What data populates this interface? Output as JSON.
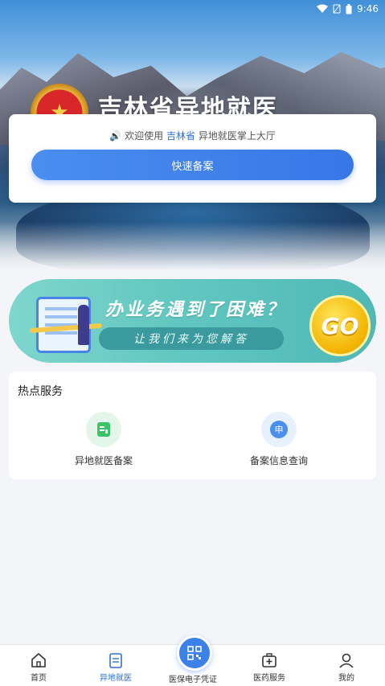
{
  "status_bar": {
    "time": "9:46"
  },
  "hero": {
    "title": "吉林省异地就医"
  },
  "welcome": {
    "prefix": "欢迎使用",
    "province": "吉林省",
    "suffix": "异地就医掌上大厅"
  },
  "quick_button": {
    "label": "快速备案"
  },
  "banner": {
    "headline": "办业务遇到了困难？",
    "subline": "让我们来为您解答",
    "go_label": "GO"
  },
  "hot_services": {
    "title": "热点服务",
    "items": [
      {
        "label": "异地就医备案",
        "icon": "document-icon"
      },
      {
        "label": "备案信息查询",
        "icon": "apply-icon"
      }
    ]
  },
  "tab_bar": {
    "items": [
      {
        "label": "首页",
        "icon": "home-icon"
      },
      {
        "label": "异地就医",
        "icon": "clipboard-icon"
      },
      {
        "label": "医保电子凭证",
        "icon": "qr-code-icon"
      },
      {
        "label": "医药服务",
        "icon": "medical-kit-icon"
      },
      {
        "label": "我的",
        "icon": "user-icon"
      }
    ],
    "active_index": 1
  },
  "colors": {
    "primary": "#3876e6",
    "active_tab": "#2f6fd6",
    "banner": "#62c7c0"
  }
}
